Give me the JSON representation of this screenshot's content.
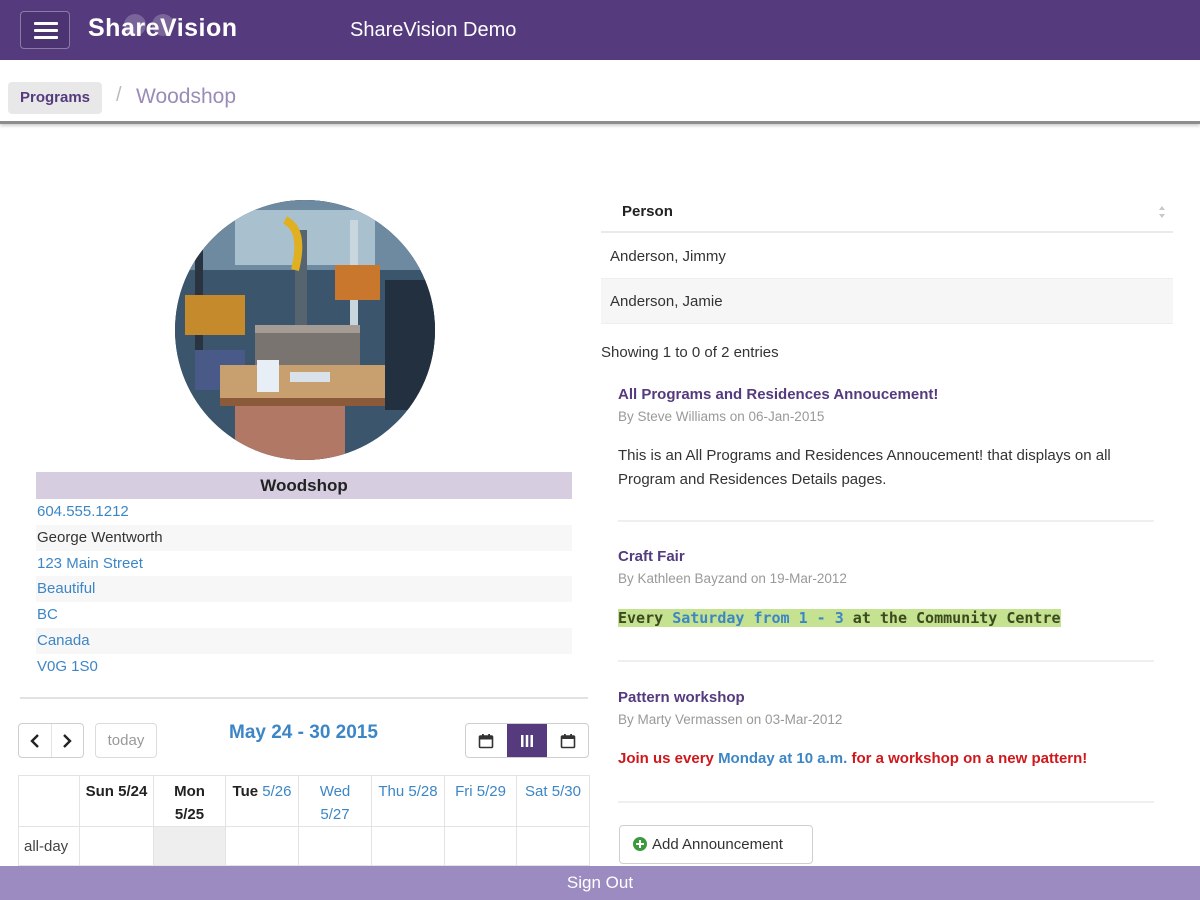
{
  "header": {
    "brand": "ShareVision",
    "app_title": "ShareVision Demo"
  },
  "breadcrumb": {
    "parent": "Programs",
    "separator": "/",
    "current": "Woodshop"
  },
  "program": {
    "name": "Woodshop",
    "photo_icon": "woodshop-photo",
    "details": [
      {
        "text": "604.555.1212",
        "type": "link"
      },
      {
        "text": "George Wentworth",
        "type": "text"
      },
      {
        "text": "123 Main Street",
        "type": "link"
      },
      {
        "text": "Beautiful",
        "type": "link"
      },
      {
        "text": "BC",
        "type": "link"
      },
      {
        "text": "Canada",
        "type": "link"
      },
      {
        "text": "V0G 1S0",
        "type": "link"
      }
    ]
  },
  "calendar": {
    "title": "May 24 - 30 2015",
    "today_label": "today",
    "prev_icon": "chevron-left-icon",
    "next_icon": "chevron-right-icon",
    "views": [
      "month-view-icon",
      "week-view-icon",
      "day-view-icon"
    ],
    "active_view": "week",
    "days": [
      {
        "name": "Sun",
        "num": "5/24"
      },
      {
        "name": "Mon",
        "num": "5/25"
      },
      {
        "name": "Tue",
        "num": "5/26"
      },
      {
        "name": "Wed",
        "num": "5/27"
      },
      {
        "name": "Thu",
        "num": "5/28"
      },
      {
        "name": "Fri",
        "num": "5/29"
      },
      {
        "name": "Sat",
        "num": "5/30"
      }
    ],
    "allday_label": "all-day"
  },
  "people_table": {
    "column": "Person",
    "rows": [
      "Anderson, Jimmy",
      "Anderson, Jamie"
    ],
    "info": "Showing 1 to 0 of 2 entries"
  },
  "announcements": [
    {
      "title": "All Programs and Residences Annoucement!",
      "meta": "By Steve Williams on 06-Jan-2015",
      "body": "This is an All Programs and Residences Annoucement! that displays on all Program and Residences Details pages."
    },
    {
      "title": "Craft Fair",
      "meta": "By Kathleen Bayzand on 19-Mar-2012",
      "body_parts": [
        "Every ",
        "Saturday from 1 - 3",
        " at the Community Centre"
      ]
    },
    {
      "title": "Pattern workshop",
      "meta": "By Marty Vermassen on 03-Mar-2012",
      "body_parts": [
        "Join us every ",
        "Monday at 10 a.m.",
        " for a workshop on a new pattern!"
      ]
    }
  ],
  "add_announcement_label": "Add Announcement",
  "footer": {
    "sign_out": "Sign Out"
  },
  "colors": {
    "brand_purple": "#553a7e",
    "footer_purple": "#9b8bc1",
    "link_blue": "#3d86c6",
    "highlight_green": "#c4e290",
    "alert_red": "#d0171b"
  }
}
